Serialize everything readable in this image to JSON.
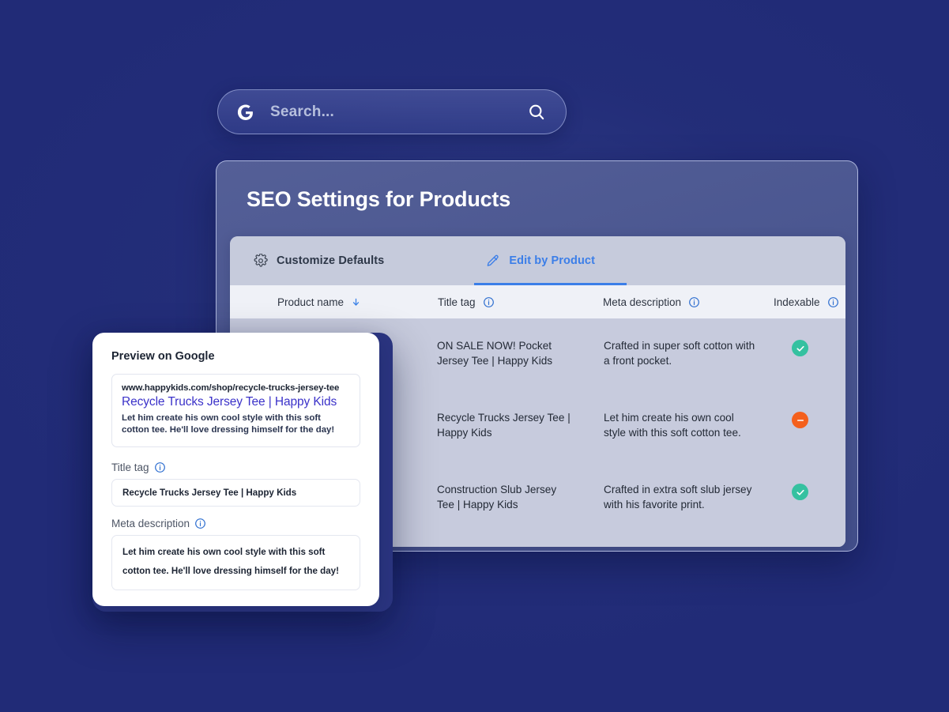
{
  "search": {
    "logo_icon": "google-g-icon",
    "placeholder": "Search...",
    "value": "",
    "search_icon": "magnifier-icon"
  },
  "panel": {
    "title": "SEO Settings for Products",
    "tabs": [
      {
        "label": "Customize Defaults",
        "icon": "gear-icon",
        "active": false
      },
      {
        "label": "Edit by Product",
        "icon": "pencil-icon",
        "active": true
      }
    ],
    "table": {
      "columns": [
        {
          "label": "Product name",
          "sort_icon": "arrow-down-icon"
        },
        {
          "label": "Title tag",
          "info_icon": "info-circle-icon"
        },
        {
          "label": "Meta description",
          "info_icon": "info-circle-icon"
        },
        {
          "label": "Indexable",
          "info_icon": "info-circle-icon"
        }
      ],
      "rows": [
        {
          "product_name": "",
          "title_tag": "ON SALE NOW! Pocket Jersey Tee | Happy Kids",
          "meta_description": "Crafted in super soft cotton with a front pocket.",
          "indexable": "yes",
          "indexable_icon": "check-circle-icon"
        },
        {
          "product_name": "",
          "title_tag": "Recycle Trucks Jersey Tee | Happy Kids",
          "meta_description": "Let him create his own cool style with this soft cotton tee.",
          "indexable": "no",
          "indexable_icon": "minus-circle-icon"
        },
        {
          "product_name": "",
          "title_tag": "Construction Slub Jersey Tee | Happy Kids",
          "meta_description": "Crafted in extra soft slub jersey with his favorite print.",
          "indexable": "yes",
          "indexable_icon": "check-circle-icon"
        }
      ]
    }
  },
  "preview": {
    "heading": "Preview on Google",
    "serp": {
      "url": "www.happykids.com/shop/recycle-trucks-jersey-tee",
      "title": "Recycle Trucks Jersey Tee | Happy Kids",
      "description": "Let him create his own cool style with this soft cotton tee. He'll love dressing himself for the day!"
    },
    "title_tag": {
      "label": "Title tag",
      "info_icon": "info-circle-icon",
      "value": "Recycle Trucks Jersey Tee | Happy Kids"
    },
    "meta_description": {
      "label": "Meta description",
      "info_icon": "info-circle-icon",
      "value": "Let him create his own cool style with this soft cotton tee. He'll love dressing himself for the day!"
    }
  },
  "colors": {
    "background": "#212b77",
    "panel": "#4a5690",
    "table_body": "#c7cbdd",
    "table_header": "#eff1f7",
    "accent_blue": "#3b7ee8",
    "serp_title": "#3b32c9",
    "badge_ok": "#35c1a0",
    "badge_off": "#f4601c"
  }
}
